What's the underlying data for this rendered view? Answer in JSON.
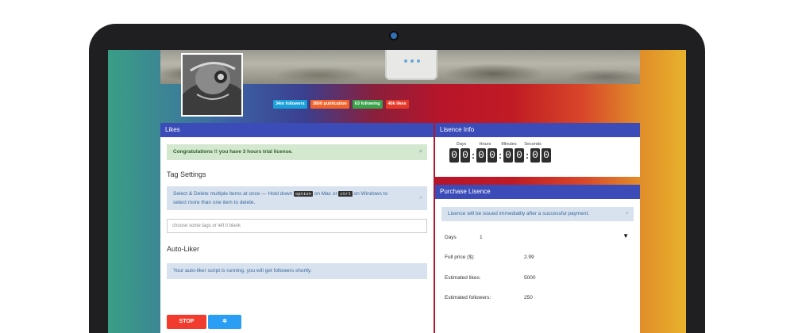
{
  "badges": [
    {
      "label": "34m followers",
      "color": "#1aa0d8"
    },
    {
      "label": "3800 publication",
      "color": "#f0632a"
    },
    {
      "label": "63 following",
      "color": "#3aa24a"
    },
    {
      "label": "40k likes",
      "color": "#e53a2a"
    }
  ],
  "likes_panel": {
    "title": "Likes",
    "trial_alert": "Congratulations !! you have 3 hours trial license.",
    "tag_settings_title": "Tag Settings",
    "instructions_part1": "Select & Delete multiple items at once — Hold down",
    "key_option": "option",
    "instructions_part2": "on Mac or",
    "key_ctrl": "ctrl",
    "instructions_part3": "on Windows to",
    "instructions_line2": "select more than one item to delete.",
    "tag_input_placeholder": "choose some tags or left it blank",
    "auto_liker_title": "Auto-Liker",
    "running_alert": "Your auto-liker script is running, you will get followers shortly.",
    "stop_label": "STOP",
    "settings_icon": "gear-icon"
  },
  "licence_info": {
    "title": "Lisence Info",
    "labels": [
      "Days",
      "Hours",
      "Minutes",
      "Seconds"
    ],
    "digits": [
      "0",
      "0",
      "0",
      "0",
      "0",
      "0",
      "0",
      "0"
    ]
  },
  "purchase": {
    "title": "Purchase Lisence",
    "alert": "Lisence will be issued immediatlly after a successful payment.",
    "days_label": "Days",
    "days_value": "1",
    "full_price_label": "Full price ($):",
    "full_price_value": "2.99",
    "est_likes_label": "Estimated likes:",
    "est_likes_value": "5000",
    "est_followers_label": "Estimated followers:",
    "est_followers_value": "250"
  }
}
